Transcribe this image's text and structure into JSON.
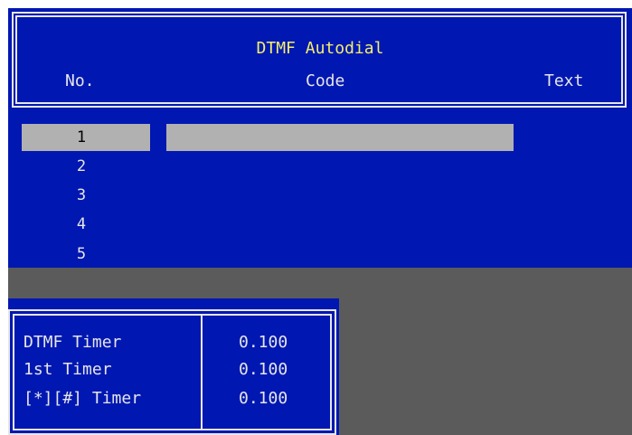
{
  "header": {
    "title": "DTMF Autodial",
    "columns": {
      "no": "No.",
      "code": "Code",
      "text": "Text"
    }
  },
  "entries": [
    {
      "no": "1",
      "code": "",
      "text": "",
      "selected": true
    },
    {
      "no": "2",
      "code": "",
      "text": ""
    },
    {
      "no": "3",
      "code": "",
      "text": ""
    },
    {
      "no": "4",
      "code": "",
      "text": ""
    },
    {
      "no": "5",
      "code": "",
      "text": ""
    }
  ],
  "timers": [
    {
      "label": "DTMF Timer",
      "value": "0.100"
    },
    {
      "label": "1st Timer",
      "value": "0.100"
    },
    {
      "label": "[*][#] Timer",
      "value": "0.100"
    }
  ],
  "colors": {
    "panel_bg": "#0017b2",
    "title_text": "#f4ef6a",
    "text": "#e6e6e6",
    "selection": "#b1b1b1",
    "background_gray": "#5b5b5b"
  }
}
